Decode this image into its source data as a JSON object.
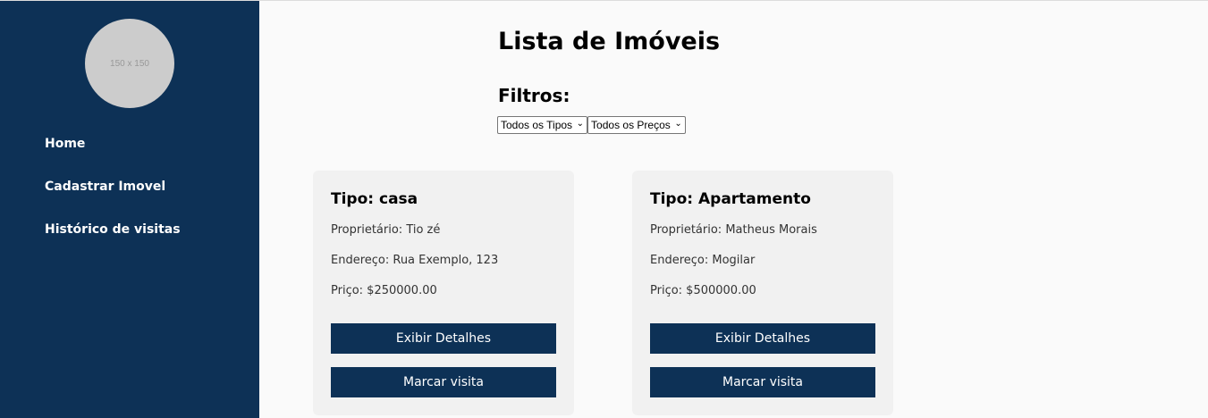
{
  "sidebar": {
    "avatar_text": "150 x 150",
    "nav": [
      "Home",
      "Cadastrar Imovel",
      "Histórico de visitas"
    ]
  },
  "main": {
    "title": "Lista de Imóveis",
    "filters_title": "Filtros:",
    "filter_type": "Todos os Tipos",
    "filter_price": "Todos os Preços"
  },
  "cards": [
    {
      "type": "Tipo: casa",
      "owner": "Proprietário: Tio zé",
      "address": "Endereço: Rua Exemplo, 123",
      "price": "Priço: $250000.00",
      "details_btn": "Exibir Detalhes",
      "visit_btn": "Marcar visita"
    },
    {
      "type": "Tipo: Apartamento",
      "owner": "Proprietário: Matheus Morais",
      "address": "Endereço: Mogilar",
      "price": "Priço: $500000.00",
      "details_btn": "Exibir Detalhes",
      "visit_btn": "Marcar visita"
    }
  ],
  "colors": {
    "sidebar_bg": "#0d3156",
    "button_bg": "#0d3156",
    "card_bg": "#f1f1f1",
    "page_bg": "#fafafa"
  }
}
